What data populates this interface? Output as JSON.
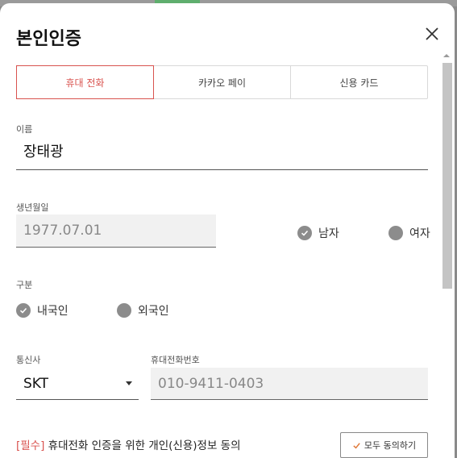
{
  "modal": {
    "title": "본인인증"
  },
  "tabs": [
    {
      "label": "휴대 전화",
      "active": true
    },
    {
      "label": "카카오 페이",
      "active": false
    },
    {
      "label": "신용 카드",
      "active": false
    }
  ],
  "name": {
    "label": "이름",
    "value": "장태광"
  },
  "birth": {
    "label": "생년월일",
    "value": "1977.07.01"
  },
  "gender": {
    "options": [
      {
        "label": "남자",
        "selected": true
      },
      {
        "label": "여자",
        "selected": false
      }
    ]
  },
  "nationality": {
    "label": "구분",
    "options": [
      {
        "label": "내국인",
        "selected": true
      },
      {
        "label": "외국인",
        "selected": false
      }
    ]
  },
  "carrier": {
    "label": "통신사",
    "value": "SKT"
  },
  "phone": {
    "label": "휴대전화번호",
    "value": "010-9411-0403"
  },
  "consent": {
    "required_tag": "[필수]",
    "text": " 휴대전화 인증을 위한 개인(신용)정보 동의",
    "agree_all_label": "모두 동의하기"
  },
  "colors": {
    "accent": "#d9534f",
    "radio": "#8c8c8c"
  }
}
